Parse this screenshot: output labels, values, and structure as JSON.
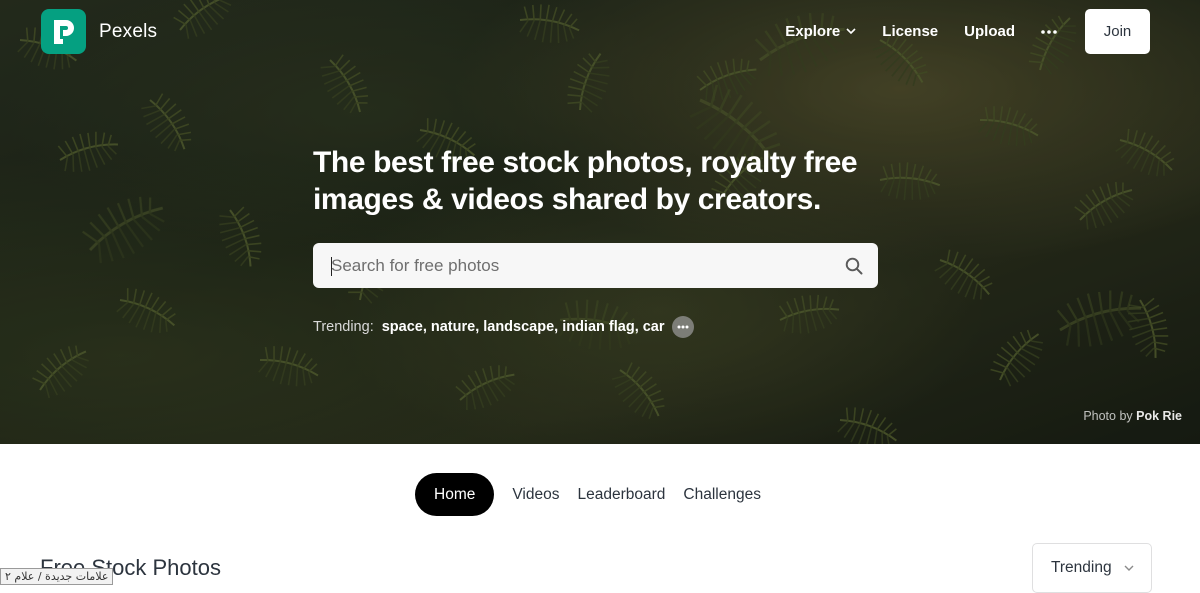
{
  "brand": {
    "name": "Pexels",
    "logo_letter": "P"
  },
  "nav": {
    "explore": "Explore",
    "license": "License",
    "upload": "Upload",
    "more_icon": "more-horizontal-icon",
    "join": "Join"
  },
  "hero": {
    "headline": "The best free stock photos, royalty free images & videos shared by creators.",
    "search_placeholder": "Search for free photos",
    "search_icon": "search-icon",
    "trending_label": "Trending:",
    "trending": [
      "space",
      "nature",
      "landscape",
      "indian flag",
      "car"
    ],
    "credit_prefix": "Photo by",
    "credit_author": "Pok Rie"
  },
  "tabs": [
    "Home",
    "Videos",
    "Leaderboard",
    "Challenges"
  ],
  "section": {
    "title": "Free Stock Photos",
    "sort_value": "Trending"
  },
  "status_tooltip": "علامات جديدة / علام ٢",
  "colors": {
    "brand_green": "#05a081",
    "text_dark": "#2c343e",
    "tab_active_bg": "#000000"
  }
}
